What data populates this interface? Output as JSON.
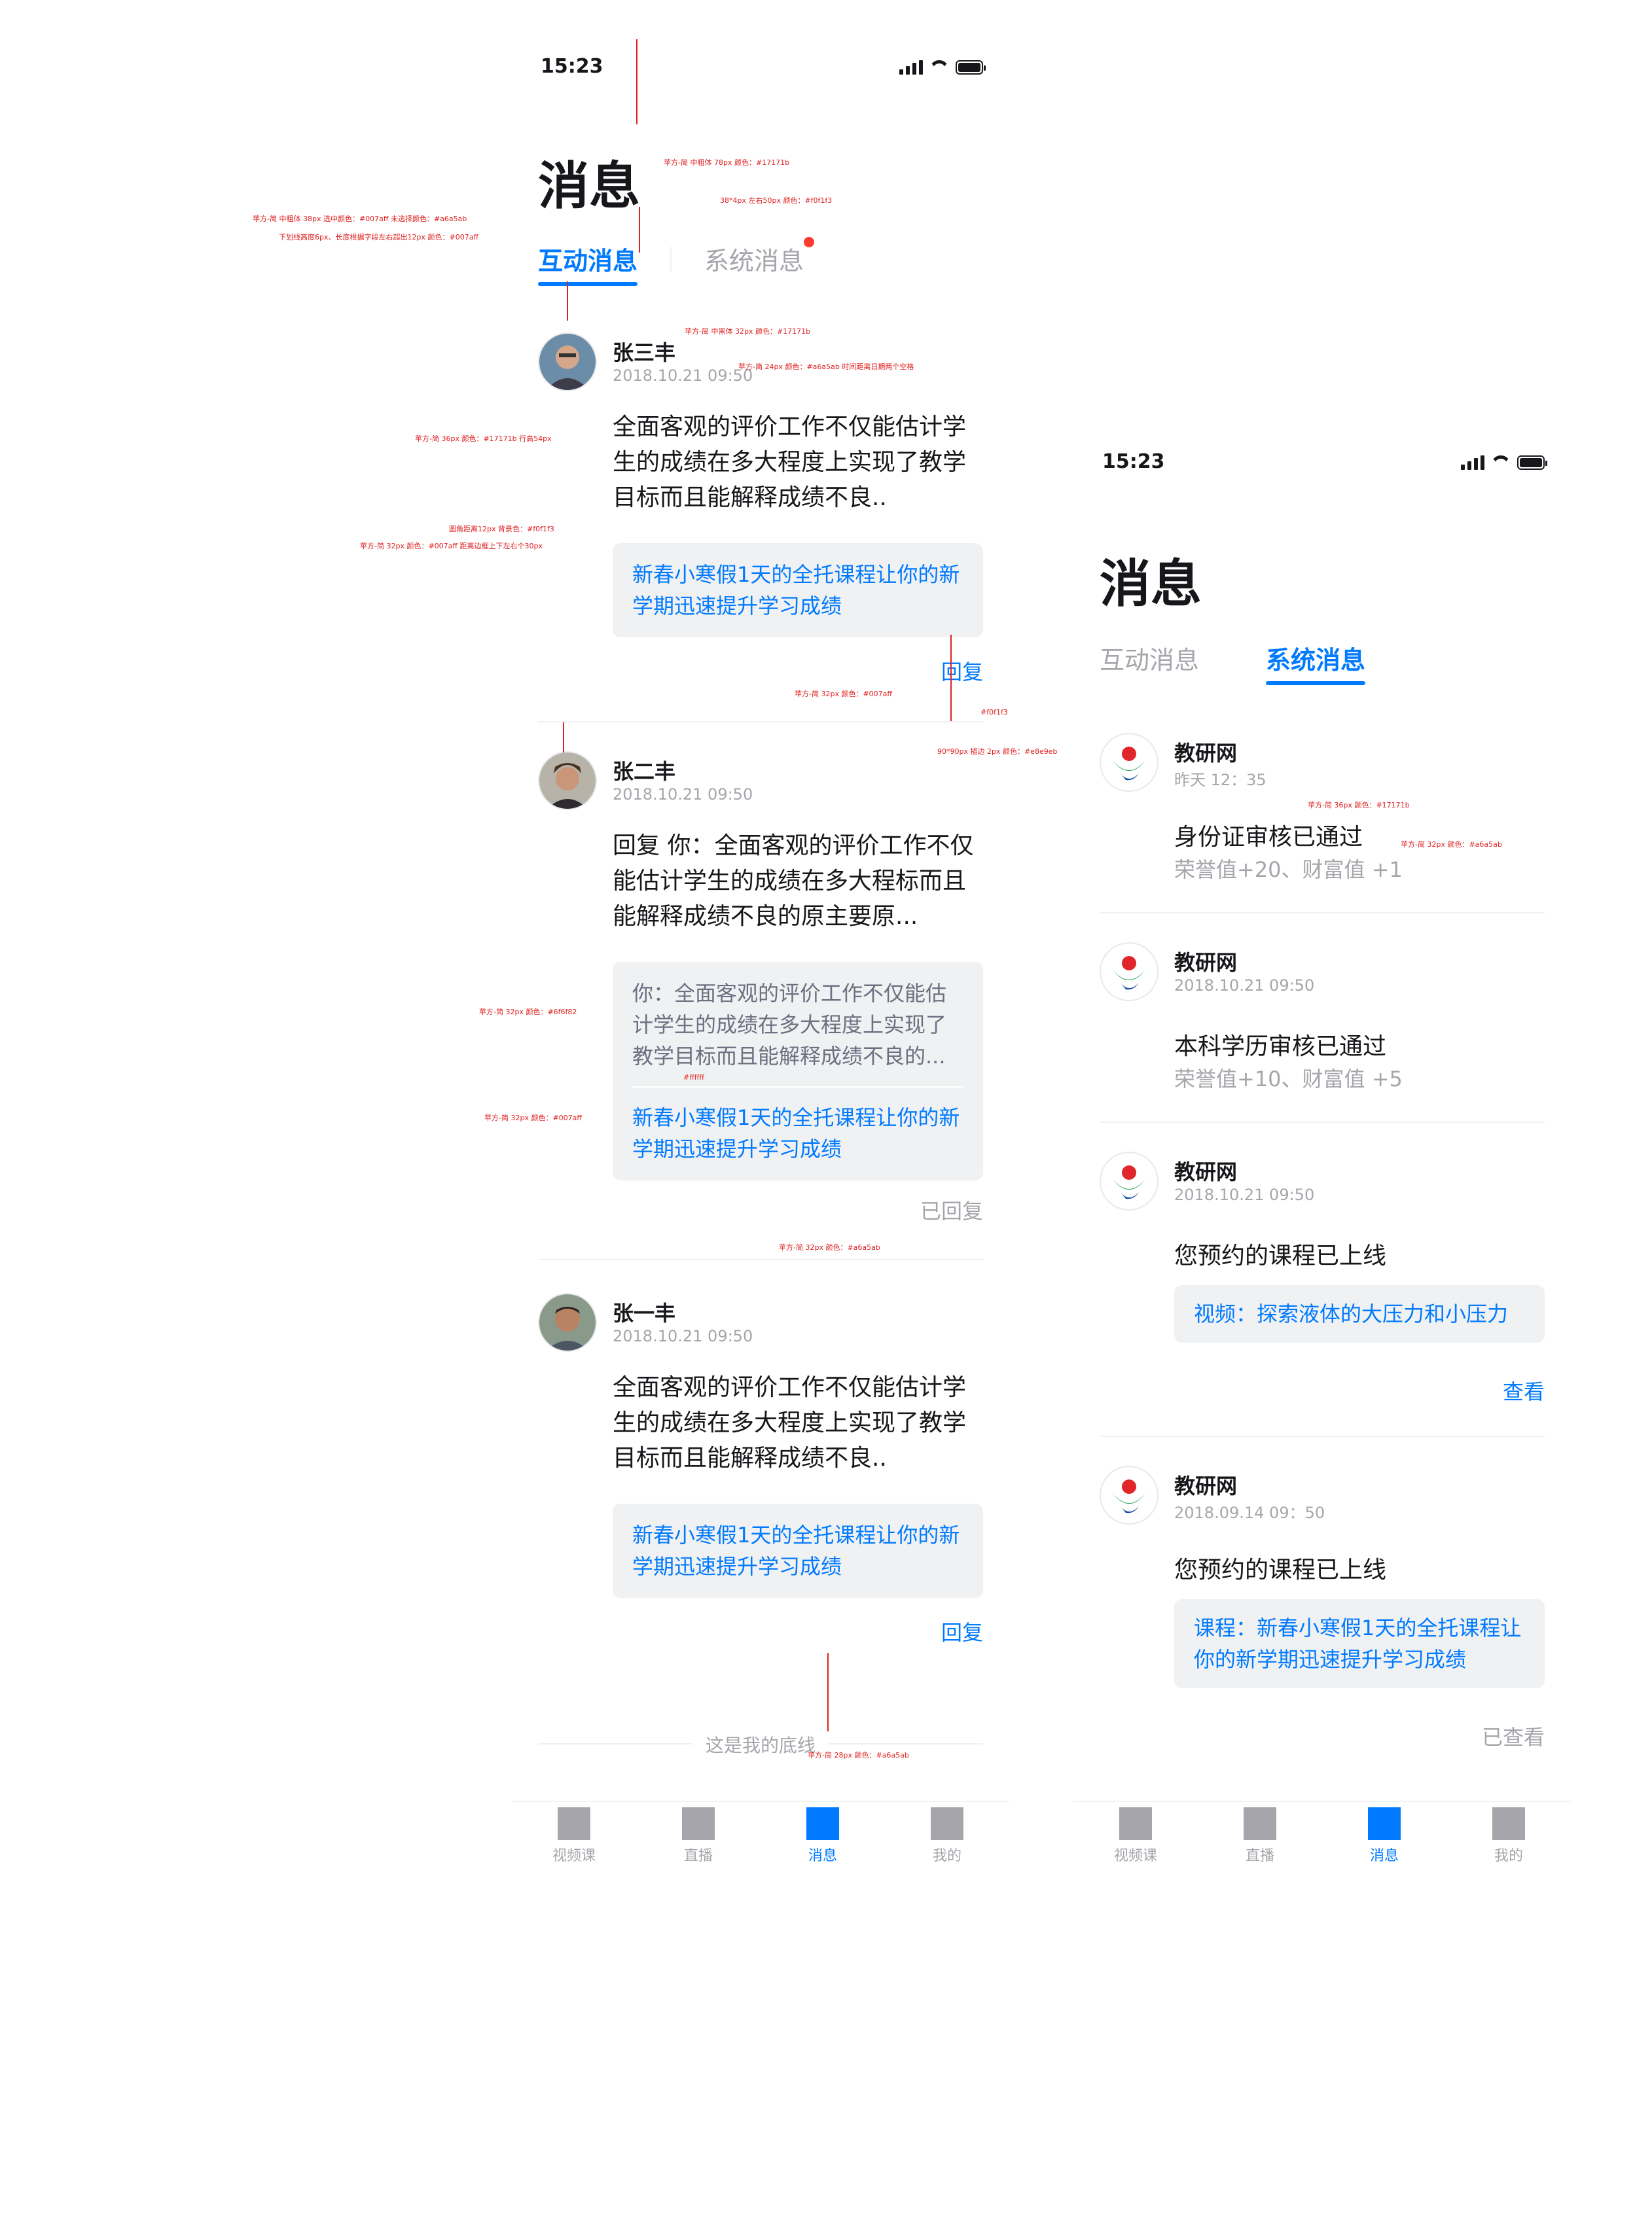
{
  "status": {
    "time": "15:23",
    "time_b": "15:23 ➤"
  },
  "screen_a": {
    "title": "消息",
    "tabs": [
      {
        "label": "互动消息",
        "active": true
      },
      {
        "label": "系统消息",
        "active": false
      }
    ],
    "items": [
      {
        "name": "张三丰",
        "time": "2018.10.21  09:50",
        "text": "全面客观的评价工作不仅能估计学生的成绩在多大程度上实现了教学目标而且能解释成绩不良..",
        "link": "新春小寒假1天的全托课程让你的新学期迅速提升学习成绩",
        "action": "回复"
      },
      {
        "name": "张二丰",
        "time": "2018.10.21  09:50",
        "text": "回复 你：全面客观的评价工作不仅能估计学生的成绩在多大程标而且能解释成绩不良的原主要原...",
        "quote": "你：全面客观的评价工作不仅能估计学生的成绩在多大程度上实现了教学目标而且能解释成绩不良的...",
        "link": "新春小寒假1天的全托课程让你的新学期迅速提升学习成绩",
        "action": "已回复"
      },
      {
        "name": "张一丰",
        "time": "2018.10.21  09:50",
        "text": "全面客观的评价工作不仅能估计学生的成绩在多大程度上实现了教学目标而且能解释成绩不良..",
        "link": "新春小寒假1天的全托课程让你的新学期迅速提升学习成绩",
        "action": "回复"
      }
    ],
    "footer": "这是我的底线"
  },
  "screen_b": {
    "title": "消息",
    "tabs": [
      {
        "label": "互动消息",
        "active": false
      },
      {
        "label": "系统消息",
        "active": true
      }
    ],
    "items": [
      {
        "name": "教研网",
        "time": "昨天 12：35",
        "title": "身份证审核已通过",
        "sub": "荣誉值+20、财富值 +1"
      },
      {
        "name": "教研网",
        "time": "2018.10.21  09:50",
        "title": "本科学历审核已通过",
        "sub": "荣誉值+10、财富值 +5"
      },
      {
        "name": "教研网",
        "time": "2018.10.21  09:50",
        "title": "您预约的课程已上线",
        "box": "视频：探索液体的大压力和小压力",
        "action": "查看"
      },
      {
        "name": "教研网",
        "time": "2018.09.14  09：50",
        "title": "您预约的课程已上线",
        "box": "课程：新春小寒假1天的全托课程让你的新学期迅速提升学习成绩",
        "action": "已查看"
      }
    ]
  },
  "tabbar": [
    {
      "label": "视频课",
      "active": false
    },
    {
      "label": "直播",
      "active": false
    },
    {
      "label": "消息",
      "active": true
    },
    {
      "label": "我的",
      "active": false
    }
  ],
  "annotations": {
    "title_spec": "苹方-简 中粗体 78px 颜色：#17171b",
    "tab_spec": "苹方-简 中粗体 38px 选中颜色：#007aff 未选择颜色：#a6a5ab",
    "underline_spec": "下划线高度6px、长度根据字段左右超出12px 颜色：#007aff",
    "sep_spec": "38*4px 左右50px 颜色：#f0f1f3",
    "name_spec": "苹方-简 中黑体 32px 颜色：#17171b",
    "time_spec": "苹方-简 24px 颜色：#a6a5ab 时间距离日期两个空格",
    "text_spec": "苹方-简 36px 颜色：#17171b 行高54px",
    "box_spec": "圆角距离12px 背景色：#f0f1f3",
    "link_spec": "苹方-简 32px 颜色：#007aff 距离边框上下左右个30px",
    "reply_spec": "苹方-简 32px 颜色：#007aff",
    "line_spec": "#f0f1f3",
    "avatar_spec": "90*90px 描边 2px 颜色：#e8e9eb",
    "quote_spec": "苹方-简 32px 颜色：#6f6f82",
    "quote_div_spec": "#ffffff",
    "link2_spec": "苹方-简 32px 颜色：#007aff",
    "replied_spec": "苹方-简 32px 颜色：#a6a5ab",
    "footer_spec": "苹方-简 28px 颜色：#a6a5ab",
    "sys_title_spec": "苹方-简 36px 颜色：#17171b",
    "sys_sub_spec": "苹方-简 32px 颜色：#a6a5ab"
  }
}
